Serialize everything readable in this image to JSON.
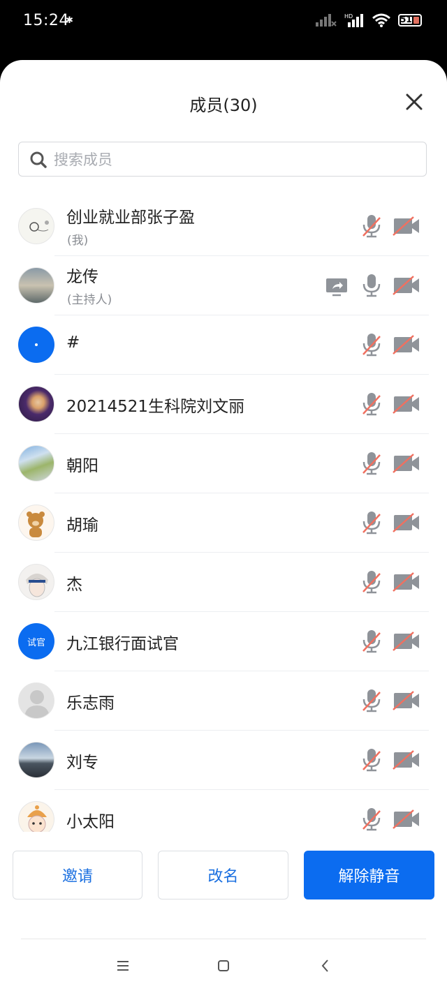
{
  "status_bar": {
    "time": "15:24",
    "battery": "51"
  },
  "header": {
    "title": "成员(30)"
  },
  "search": {
    "placeholder": "搜索成员"
  },
  "members": [
    {
      "name": "创业就业部张子盈",
      "role": "(我)",
      "mic": "muted",
      "video": "off",
      "sharing": false
    },
    {
      "name": "龙传",
      "role": "(主持人)",
      "mic": "on",
      "video": "off",
      "sharing": true
    },
    {
      "name": "#",
      "role": "",
      "mic": "muted",
      "video": "off",
      "sharing": false
    },
    {
      "name": "20214521生科院刘文丽",
      "role": "",
      "mic": "muted",
      "video": "off",
      "sharing": false
    },
    {
      "name": "朝阳",
      "role": "",
      "mic": "muted",
      "video": "off",
      "sharing": false
    },
    {
      "name": "胡瑜",
      "role": "",
      "mic": "muted",
      "video": "off",
      "sharing": false
    },
    {
      "name": "杰",
      "role": "",
      "mic": "muted",
      "video": "off",
      "sharing": false
    },
    {
      "name": "九江银行面试官",
      "role": "",
      "avatar_text": "试官",
      "mic": "muted",
      "video": "off",
      "sharing": false
    },
    {
      "name": "乐志雨",
      "role": "",
      "mic": "muted",
      "video": "off",
      "sharing": false
    },
    {
      "name": "刘专",
      "role": "",
      "mic": "muted",
      "video": "off",
      "sharing": false
    },
    {
      "name": "小太阳",
      "role": "",
      "mic": "muted",
      "video": "off",
      "sharing": false
    }
  ],
  "actions": {
    "invite": "邀请",
    "rename": "改名",
    "unmute": "解除静音"
  },
  "colors": {
    "accent": "#0b6cf0",
    "muted_slash": "#f07060",
    "icon_gray": "#8f9399"
  }
}
